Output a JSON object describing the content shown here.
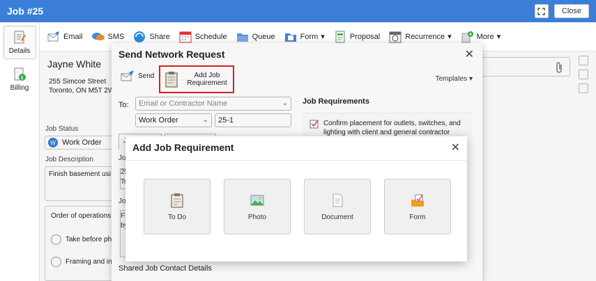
{
  "window": {
    "title": "Job #25",
    "close_label": "Close"
  },
  "leftnav": {
    "items": [
      {
        "label": "Details"
      },
      {
        "label": "Billing"
      }
    ]
  },
  "toolbar": {
    "items": [
      "Email",
      "SMS",
      "Share",
      "Schedule",
      "Queue",
      "Form",
      "Proposal",
      "Recurrence",
      "More"
    ]
  },
  "customer": {
    "name": "Jayne White",
    "address_line1": "255 Simcoe Street",
    "address_line2": "Toronto, ON M5T 2W"
  },
  "job": {
    "status_label": "Job Status",
    "status_value": "Work Order",
    "status_badge": "W",
    "description_label": "Job Description",
    "description_value": "Finish basement usi",
    "order_title": "Order of operations",
    "order_items": [
      "Take before ph",
      "Framing and in"
    ]
  },
  "modal1": {
    "title": "Send Network Request",
    "send_label": "Send",
    "add_req_label": "Add Job Requirement",
    "templates_label": "Templates",
    "to_label": "To:",
    "to_placeholder": "Email or Contractor Name",
    "type_value": "Work Order",
    "number_value": "25-1",
    "job_req_title": "Job Requirements",
    "req_item": "Confirm placement for outlets, switches, and lighting with client and general contractor",
    "tab1": "J",
    "label_job1": "Job",
    "text_25": "25",
    "text_to": "To",
    "label_job2": "Job",
    "text_fi": "Fi",
    "text_by": "by",
    "shared_label": "Shared Job Contact Details"
  },
  "modal2": {
    "title": "Add Job Requirement",
    "choices": [
      {
        "label": "To Do"
      },
      {
        "label": "Photo"
      },
      {
        "label": "Document"
      },
      {
        "label": "Form"
      }
    ]
  }
}
